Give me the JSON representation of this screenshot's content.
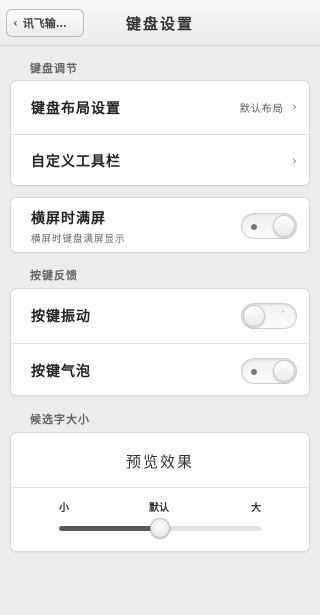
{
  "header": {
    "back_label": "讯飞输…",
    "title": "键盘设置"
  },
  "sections": {
    "keyboard_adjust": "键盘调节",
    "key_feedback": "按键反馈",
    "candidate_size": "候选字大小"
  },
  "keyboard_adjust": {
    "layout_label": "键盘布局设置",
    "layout_value": "默认布局",
    "toolbar_label": "自定义工具栏"
  },
  "landscape": {
    "label": "横屏时满屏",
    "sublabel": "横屏时键盘满屏显示",
    "enabled": true
  },
  "key_feedback": {
    "vibration_label": "按键振动",
    "vibration_enabled": false,
    "bubble_label": "按键气泡",
    "bubble_enabled": true
  },
  "candidate": {
    "preview_text": "预览效果",
    "small_label": "小",
    "default_label": "默认",
    "large_label": "大",
    "level": 0.5
  }
}
